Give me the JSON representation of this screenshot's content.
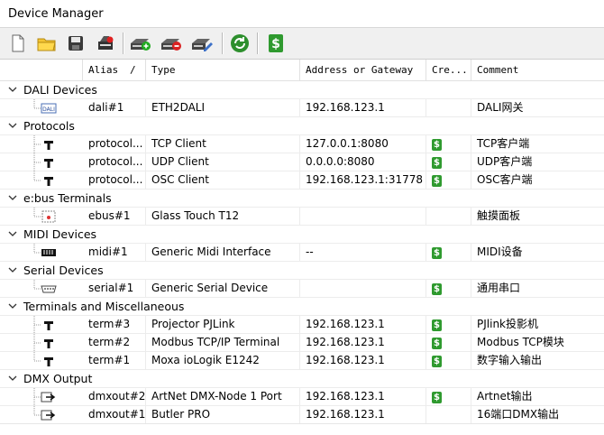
{
  "window": {
    "title": "Device Manager"
  },
  "toolbar": {
    "buttons": [
      {
        "name": "new-document-icon"
      },
      {
        "name": "open-folder-icon"
      },
      {
        "name": "save-disk-icon"
      },
      {
        "name": "device-settings-icon"
      },
      {
        "name": "add-device-icon"
      },
      {
        "name": "remove-device-icon"
      },
      {
        "name": "edit-device-icon"
      },
      {
        "name": "refresh-icon"
      },
      {
        "name": "credit-icon"
      }
    ]
  },
  "columns": [
    "Alias",
    "/",
    "Type",
    "Address or Gateway",
    "Cre...",
    "Comment"
  ],
  "groups": [
    {
      "title": "DALI Devices",
      "rows": [
        {
          "icon": "dali-icon",
          "alias": "dali#1",
          "type": "ETH2DALI",
          "address": "192.168.123.1",
          "credit": false,
          "comment": "DALI网关"
        }
      ]
    },
    {
      "title": "Protocols",
      "rows": [
        {
          "icon": "protocol-icon",
          "alias": "protocol...",
          "type": "TCP Client",
          "address": "127.0.0.1:8080",
          "credit": true,
          "comment": "TCP客户端"
        },
        {
          "icon": "protocol-icon",
          "alias": "protocol...",
          "type": "UDP Client",
          "address": "0.0.0.0:8080",
          "credit": true,
          "comment": "UDP客户端"
        },
        {
          "icon": "protocol-icon",
          "alias": "protocol...",
          "type": "OSC Client",
          "address": "192.168.123.1:31778",
          "credit": true,
          "comment": "OSC客户端"
        }
      ]
    },
    {
      "title": "e:bus Terminals",
      "rows": [
        {
          "icon": "ebus-icon",
          "alias": "ebus#1",
          "type": "Glass Touch T12",
          "address": "",
          "credit": false,
          "comment": "触摸面板"
        }
      ]
    },
    {
      "title": "MIDI Devices",
      "rows": [
        {
          "icon": "midi-icon",
          "alias": "midi#1",
          "type": "Generic Midi Interface",
          "address": "--",
          "credit": true,
          "comment": "MIDI设备"
        }
      ]
    },
    {
      "title": "Serial Devices",
      "rows": [
        {
          "icon": "serial-icon",
          "alias": "serial#1",
          "type": "Generic Serial Device",
          "address": "",
          "credit": true,
          "comment": "通用串口"
        }
      ]
    },
    {
      "title": "Terminals and Miscellaneous",
      "rows": [
        {
          "icon": "terminal-icon",
          "alias": "term#3",
          "type": "Projector PJLink",
          "address": "192.168.123.1",
          "credit": true,
          "comment": "PJlink投影机"
        },
        {
          "icon": "terminal-icon",
          "alias": "term#2",
          "type": "Modbus TCP/IP Terminal",
          "address": "192.168.123.1",
          "credit": true,
          "comment": "Modbus TCP模块"
        },
        {
          "icon": "terminal-icon",
          "alias": "term#1",
          "type": "Moxa ioLogik E1242",
          "address": "192.168.123.1",
          "credit": true,
          "comment": "数字输入输出"
        }
      ]
    },
    {
      "title": "DMX Output",
      "rows": [
        {
          "icon": "dmx-output-icon",
          "alias": "dmxout#2",
          "type": "ArtNet DMX-Node 1 Port",
          "address": "192.168.123.1",
          "credit": true,
          "comment": "Artnet输出"
        },
        {
          "icon": "dmx-output-icon",
          "alias": "dmxout#1",
          "type": "Butler PRO",
          "address": "192.168.123.1",
          "credit": false,
          "comment": "16端口DMX输出"
        }
      ]
    }
  ],
  "credit_symbol": "$",
  "colors": {
    "credit_green": "#2f9a2f",
    "toolbar_bg": "#f0f0f0"
  }
}
